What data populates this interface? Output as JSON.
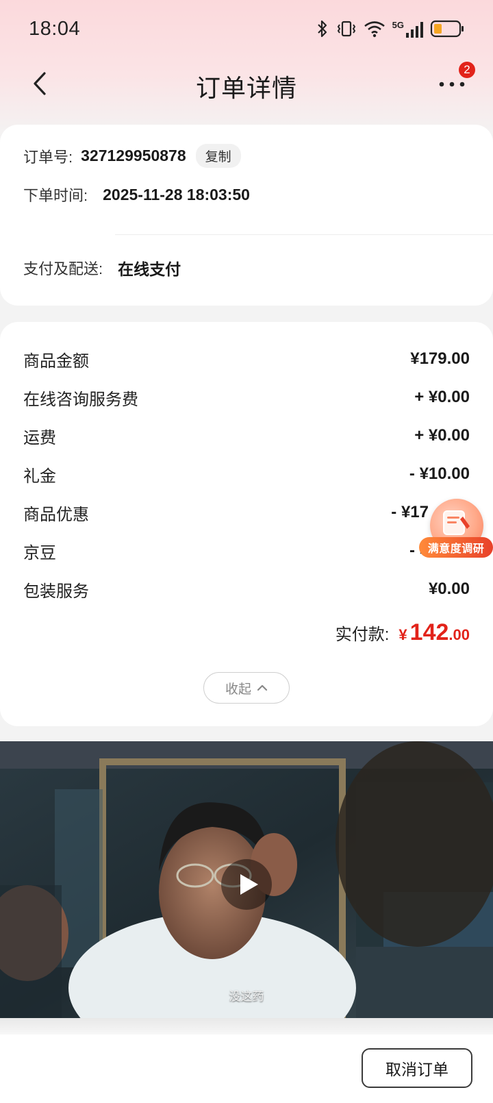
{
  "status_bar": {
    "time": "18:04",
    "icons": [
      "bluetooth-icon",
      "vibrate-icon",
      "wifi-icon",
      "5g-signal-icon",
      "battery-low-icon"
    ],
    "network_label": "5G"
  },
  "nav": {
    "title": "订单详情",
    "back_icon": "chevron-left-icon",
    "more_icon": "more-dots-icon",
    "badge_count": "2"
  },
  "order_info": {
    "order_no_label": "订单号:",
    "order_no": "327129950878",
    "copy_label": "复制",
    "time_label": "下单时间:",
    "time_value": "2025-11-28 18:03:50",
    "pay_label": "支付及配送:",
    "pay_value": "在线支付"
  },
  "price_details": {
    "items": [
      {
        "label": "商品金额",
        "value": "¥179.00"
      },
      {
        "label": "在线咨询服务费",
        "value": "+ ¥0.00"
      },
      {
        "label": "运费",
        "value": "+ ¥0.00"
      },
      {
        "label": "礼金",
        "value": "- ¥10.00"
      },
      {
        "label": "商品优惠",
        "value": "- ¥17"
      },
      {
        "label": "京豆",
        "value": "- ¥"
      },
      {
        "label": "包装服务",
        "value": "¥0.00"
      }
    ],
    "total_label": "实付款:",
    "total_symbol": "¥",
    "total_int": "142",
    "total_dec": ".00",
    "collapse_label": "收起"
  },
  "survey": {
    "label": "满意度调研",
    "icon": "survey-icon"
  },
  "video": {
    "subtitle": "没这药",
    "play_icon": "play-icon"
  },
  "bottom": {
    "cancel_label": "取消订单"
  },
  "colors": {
    "accent_red": "#e2231a",
    "header_pink": "#fbd9dc"
  }
}
